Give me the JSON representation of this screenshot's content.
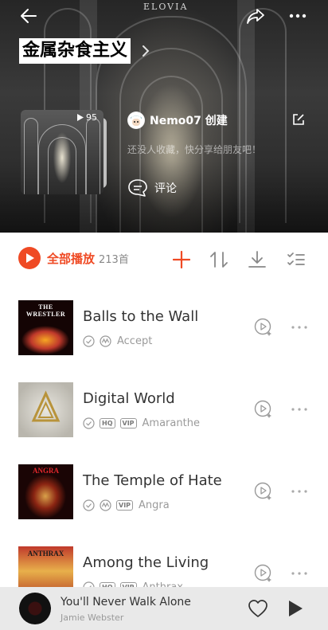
{
  "header": {
    "playlist_title": "金属杂食主义",
    "logo_text": "ELOVIA",
    "play_count": "95",
    "creator_name": "Nemo07 创建",
    "description": "还没人收藏，快分享给朋友吧！",
    "comment_label": "评论"
  },
  "toolbar": {
    "play_all_label": "全部播放",
    "song_count": "213首"
  },
  "songs": [
    {
      "title": "Balls to the Wall",
      "artist": "Accept",
      "tags": []
    },
    {
      "title": "Digital World",
      "artist": "Amaranthe",
      "tags": [
        "HQ",
        "VIP"
      ]
    },
    {
      "title": "The Temple of Hate",
      "artist": "Angra",
      "tags": [
        "VIP"
      ]
    },
    {
      "title": "Among the Living",
      "artist": "Anthrax",
      "tags": [
        "HQ",
        "VIP"
      ]
    }
  ],
  "album_art_text": {
    "wrestler_title": "THE WRESTLER",
    "angra_logo": "ANGRA",
    "anthrax_logo": "ANTHRAX"
  },
  "mini_player": {
    "title": "You'll Never Walk Alone",
    "artist": "Jamie Webster"
  },
  "colors": {
    "accent": "#ef4a24",
    "mini_player_bg": "#e9e9e9"
  },
  "icons": {
    "back": "back-arrow-icon",
    "share": "share-icon",
    "more": "more-icon",
    "edit": "edit-icon",
    "comment": "comment-icon",
    "add": "add-icon",
    "sort": "sort-icon",
    "download": "download-icon",
    "multi_select": "multi-select-icon"
  }
}
